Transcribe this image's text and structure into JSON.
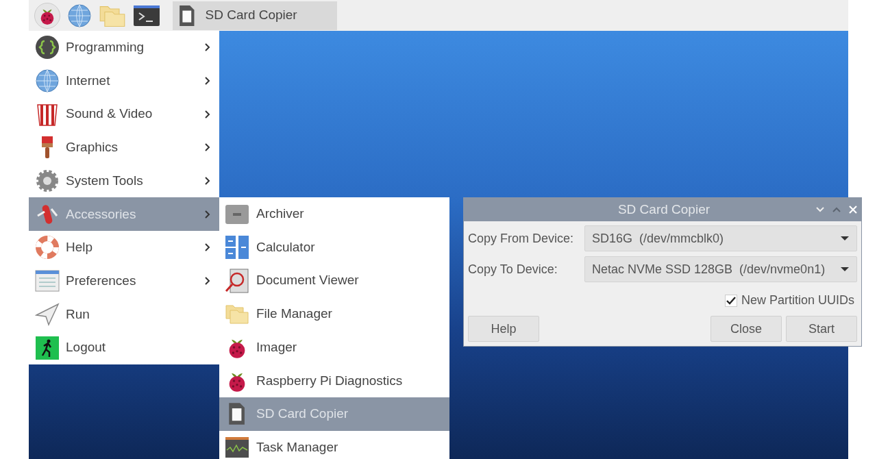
{
  "taskbar": {
    "launchers": [
      {
        "kind": "menu"
      },
      {
        "kind": "browser"
      },
      {
        "kind": "files"
      },
      {
        "kind": "terminal"
      }
    ],
    "tasks": [
      {
        "label": "SD Card Copier",
        "selected": true
      }
    ]
  },
  "main_menu": {
    "items": [
      {
        "label": "Programming",
        "submenu": true,
        "selected": false
      },
      {
        "label": "Internet",
        "submenu": true,
        "selected": false
      },
      {
        "label": "Sound & Video",
        "submenu": true,
        "selected": false
      },
      {
        "label": "Graphics",
        "submenu": true,
        "selected": false
      },
      {
        "label": "System Tools",
        "submenu": true,
        "selected": false
      },
      {
        "label": "Accessories",
        "submenu": true,
        "selected": true
      },
      {
        "label": "Help",
        "submenu": true,
        "selected": false
      },
      {
        "label": "Preferences",
        "submenu": true,
        "selected": false
      },
      {
        "label": "Run",
        "submenu": false,
        "selected": false
      },
      {
        "label": "Logout",
        "submenu": false,
        "selected": false
      }
    ]
  },
  "submenu": {
    "items": [
      {
        "label": "Archiver",
        "selected": false
      },
      {
        "label": "Calculator",
        "selected": false
      },
      {
        "label": "Document Viewer",
        "selected": false
      },
      {
        "label": "File Manager",
        "selected": false
      },
      {
        "label": "Imager",
        "selected": false
      },
      {
        "label": "Raspberry Pi Diagnostics",
        "selected": false
      },
      {
        "label": "SD Card Copier",
        "selected": true
      },
      {
        "label": "Task Manager",
        "selected": false
      }
    ]
  },
  "dialog": {
    "title": "SD Card Copier",
    "fields": [
      {
        "label": "Copy From Device:",
        "value": "SD16G  (/dev/mmcblk0)"
      },
      {
        "label": "Copy To Device:",
        "value": "Netac NVMe SSD 128GB  (/dev/nvme0n1)"
      }
    ],
    "checkbox": {
      "label": "New Partition UUIDs",
      "checked": true
    },
    "buttons": [
      {
        "label": "Help",
        "kind": "left"
      },
      {
        "label": "Close",
        "kind": "right"
      },
      {
        "label": "Start",
        "kind": "right"
      }
    ]
  }
}
